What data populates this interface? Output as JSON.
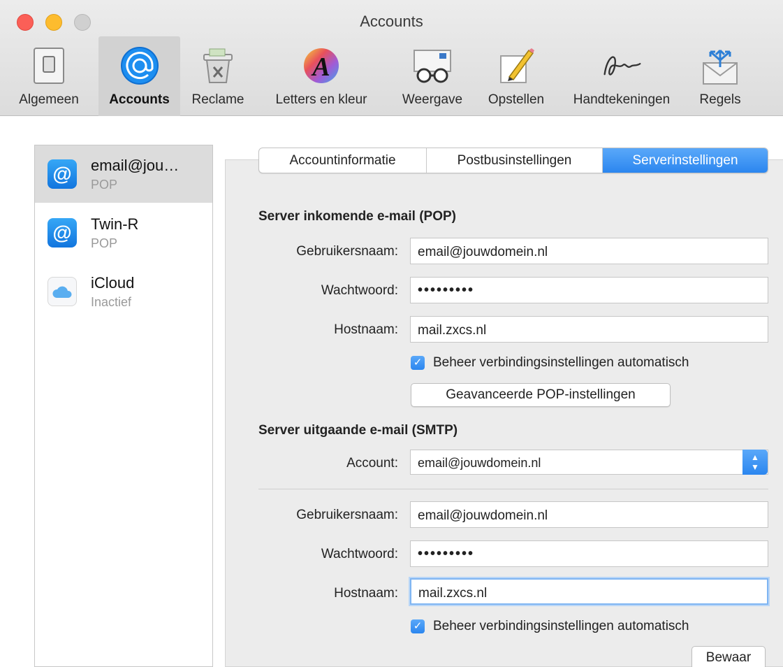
{
  "window": {
    "title": "Accounts"
  },
  "toolbar": {
    "items": [
      {
        "label": "Algemeen",
        "icon": "switch-icon"
      },
      {
        "label": "Accounts",
        "icon": "at-sign-icon"
      },
      {
        "label": "Reclame",
        "icon": "junk-mail-icon"
      },
      {
        "label": "Letters en kleur",
        "icon": "font-color-icon"
      },
      {
        "label": "Weergave",
        "icon": "glasses-icon"
      },
      {
        "label": "Opstellen",
        "icon": "compose-pencil-icon"
      },
      {
        "label": "Handtekeningen",
        "icon": "signature-icon"
      },
      {
        "label": "Regels",
        "icon": "rules-envelope-icon"
      }
    ],
    "active": "Accounts"
  },
  "sidebar": {
    "accounts": [
      {
        "name": "email@jou…",
        "type": "POP",
        "selected": true
      },
      {
        "name": "Twin-R",
        "type": "POP",
        "selected": false
      },
      {
        "name": "iCloud",
        "type": "Inactief",
        "selected": false
      }
    ]
  },
  "tabs": {
    "items": [
      "Accountinformatie",
      "Postbusinstellingen",
      "Serverinstellingen"
    ],
    "active": "Serverinstellingen"
  },
  "incoming": {
    "heading": "Server inkomende e-mail (POP)",
    "username_label": "Gebruikersnaam:",
    "username": "email@jouwdomein.nl",
    "password_label": "Wachtwoord:",
    "password": "•••••••••",
    "host_label": "Hostnaam:",
    "host": "mail.zxcs.nl",
    "auto_manage": "Beheer verbindingsinstellingen automatisch",
    "advanced_button": "Geavanceerde POP-instellingen"
  },
  "outgoing": {
    "heading": "Server uitgaande e-mail (SMTP)",
    "account_label": "Account:",
    "account": "email@jouwdomein.nl",
    "username_label": "Gebruikersnaam:",
    "username": "email@jouwdomein.nl",
    "password_label": "Wachtwoord:",
    "password": "•••••••••",
    "host_label": "Hostnaam:",
    "host": "mail.zxcs.nl",
    "auto_manage": "Beheer verbindingsinstellingen automatisch",
    "save_button": "Bewaar"
  },
  "colors": {
    "accent": "#2b86ef",
    "close": "#fb5f57",
    "minimize": "#fdbc2e"
  }
}
